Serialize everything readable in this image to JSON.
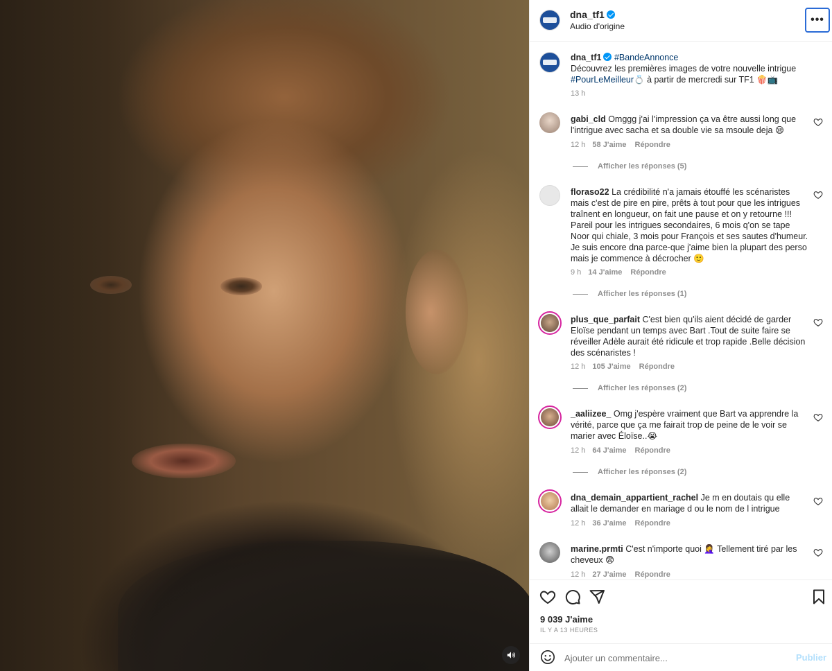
{
  "post": {
    "username": "dna_tf1",
    "audio": "Audio d'origine",
    "more_label": "•••"
  },
  "caption": {
    "username": "dna_tf1",
    "hashtag1": "#BandeAnnonce",
    "text1": "Découvrez les premières images de votre nouvelle intrigue",
    "hashtag2": "#PourLeMeilleur",
    "text2": "💍 à partir de mercredi sur TF1 🍿📺",
    "time": "13 h"
  },
  "comments": [
    {
      "username": "gabi_cld",
      "text": "Omggg j'ai l'impression ça va être aussi long que l'intrigue avec sacha et sa double vie sa msoule deja 😪",
      "time": "12 h",
      "likes": "58 J'aime",
      "reply": "Répondre",
      "replies": "Afficher les réponses (5)"
    },
    {
      "username": "floraso22",
      "text": "La crédibilité n'a jamais étouffé les scénaristes mais c'est de pire en pire, prêts à tout pour que les intrigues traînent en longueur, on fait une pause et on y retourne !!! Pareil pour les intrigues secondaires, 6 mois q'on se tape Noor qui chiale, 3 mois pour François et ses sautes d'humeur. Je suis encore dna parce-que j'aime bien la plupart des perso mais je commence à décrocher 🙂",
      "time": "9 h",
      "likes": "14 J'aime",
      "reply": "Répondre",
      "replies": "Afficher les réponses (1)"
    },
    {
      "username": "plus_que_parfait",
      "text": "C'est bien qu'ils aient décidé de garder Eloïse pendant un temps avec Bart .Tout de suite faire se réveiller Adèle aurait été ridicule et trop rapide .Belle décision des scénaristes !",
      "time": "12 h",
      "likes": "105 J'aime",
      "reply": "Répondre",
      "replies": "Afficher les réponses (2)"
    },
    {
      "username": "_aaliizee_",
      "text": "Omg j'espère vraiment que Bart va apprendre la vérité, parce que ça me fairait trop de peine de le voir se marier avec Éloïse..😭",
      "time": "12 h",
      "likes": "64 J'aime",
      "reply": "Répondre",
      "replies": "Afficher les réponses (2)"
    },
    {
      "username": "dna_demain_appartient_rachel",
      "text": "Je m en doutais qu elle allait le demander en mariage d ou le nom de l intrigue",
      "time": "12 h",
      "likes": "36 J'aime",
      "reply": "Répondre"
    },
    {
      "username": "marine.prmti",
      "text": "C'est n'importe quoi 🤦‍♀️ Tellement tiré par les cheveux 😨",
      "time": "12 h",
      "likes": "27 J'aime",
      "reply": "Répondre"
    }
  ],
  "actions": {
    "likes": "9 039 J'aime",
    "time_ago": "IL Y A 13 HEURES"
  },
  "comment_box": {
    "placeholder": "Ajouter un commentaire...",
    "publish": "Publier"
  },
  "icons": [
    "speaker-icon",
    "verified-icon",
    "more-icon",
    "heart-icon",
    "comment-icon",
    "share-icon",
    "bookmark-icon",
    "emoji-icon"
  ],
  "colors": {
    "brand_blue": "#1d4f9a",
    "hashtag": "#00376b",
    "verified": "#0095f6",
    "publish": "#b2dffc",
    "secondary_text": "#8e8e8e"
  }
}
